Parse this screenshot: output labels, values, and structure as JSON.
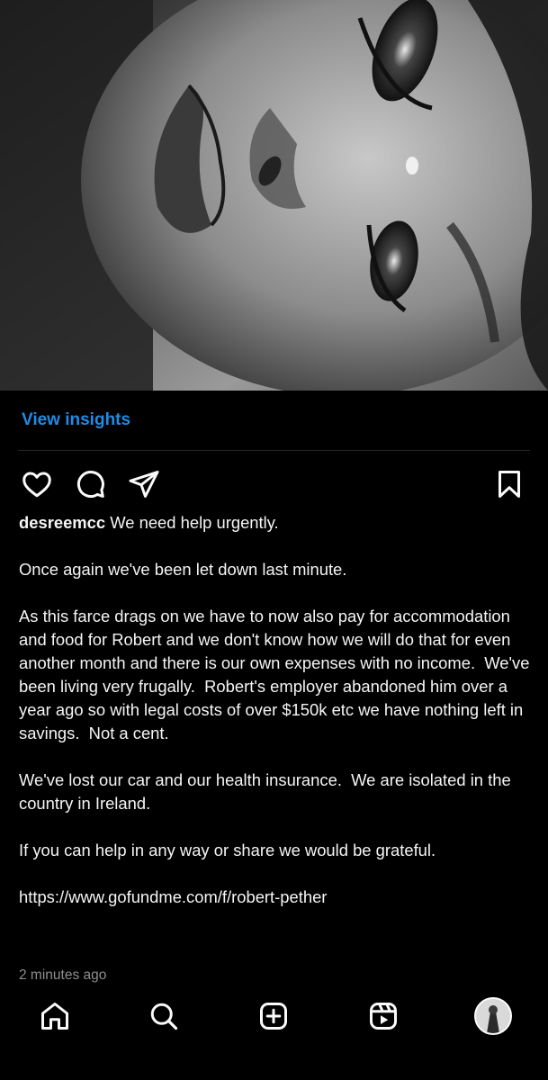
{
  "post": {
    "image_alt": "Black and white pencil drawing of a face with a tear",
    "insights_label": "View insights",
    "username": "desreemcc",
    "caption_first": " We need help urgently.",
    "caption_paragraphs": [
      "Once again we've been let down last minute.",
      "As this farce drags on we have to now also pay for accommodation and food for Robert and we don't know how we will do that for even another month and there is our own expenses with no income.  We've been living very frugally.  Robert's employer abandoned him over a year ago so with legal costs of over $150k etc we have nothing left in savings.  Not a cent.",
      "We've lost our car and our health insurance.  We are isolated in the country in Ireland.",
      "If you can help in any way or share we would be grateful.",
      "https://www.gofundme.com/f/robert-pether"
    ],
    "timestamp": "2 minutes ago"
  },
  "actions": {
    "like_icon": "heart-icon",
    "comment_icon": "comment-icon",
    "share_icon": "send-icon",
    "save_icon": "bookmark-icon"
  },
  "nav": {
    "items": [
      "home-icon",
      "search-icon",
      "create-icon",
      "reels-icon",
      "profile-avatar"
    ]
  },
  "colors": {
    "background": "#000000",
    "text": "#f5f5f5",
    "link": "#1f8ce6",
    "muted": "#8e8e8e"
  }
}
